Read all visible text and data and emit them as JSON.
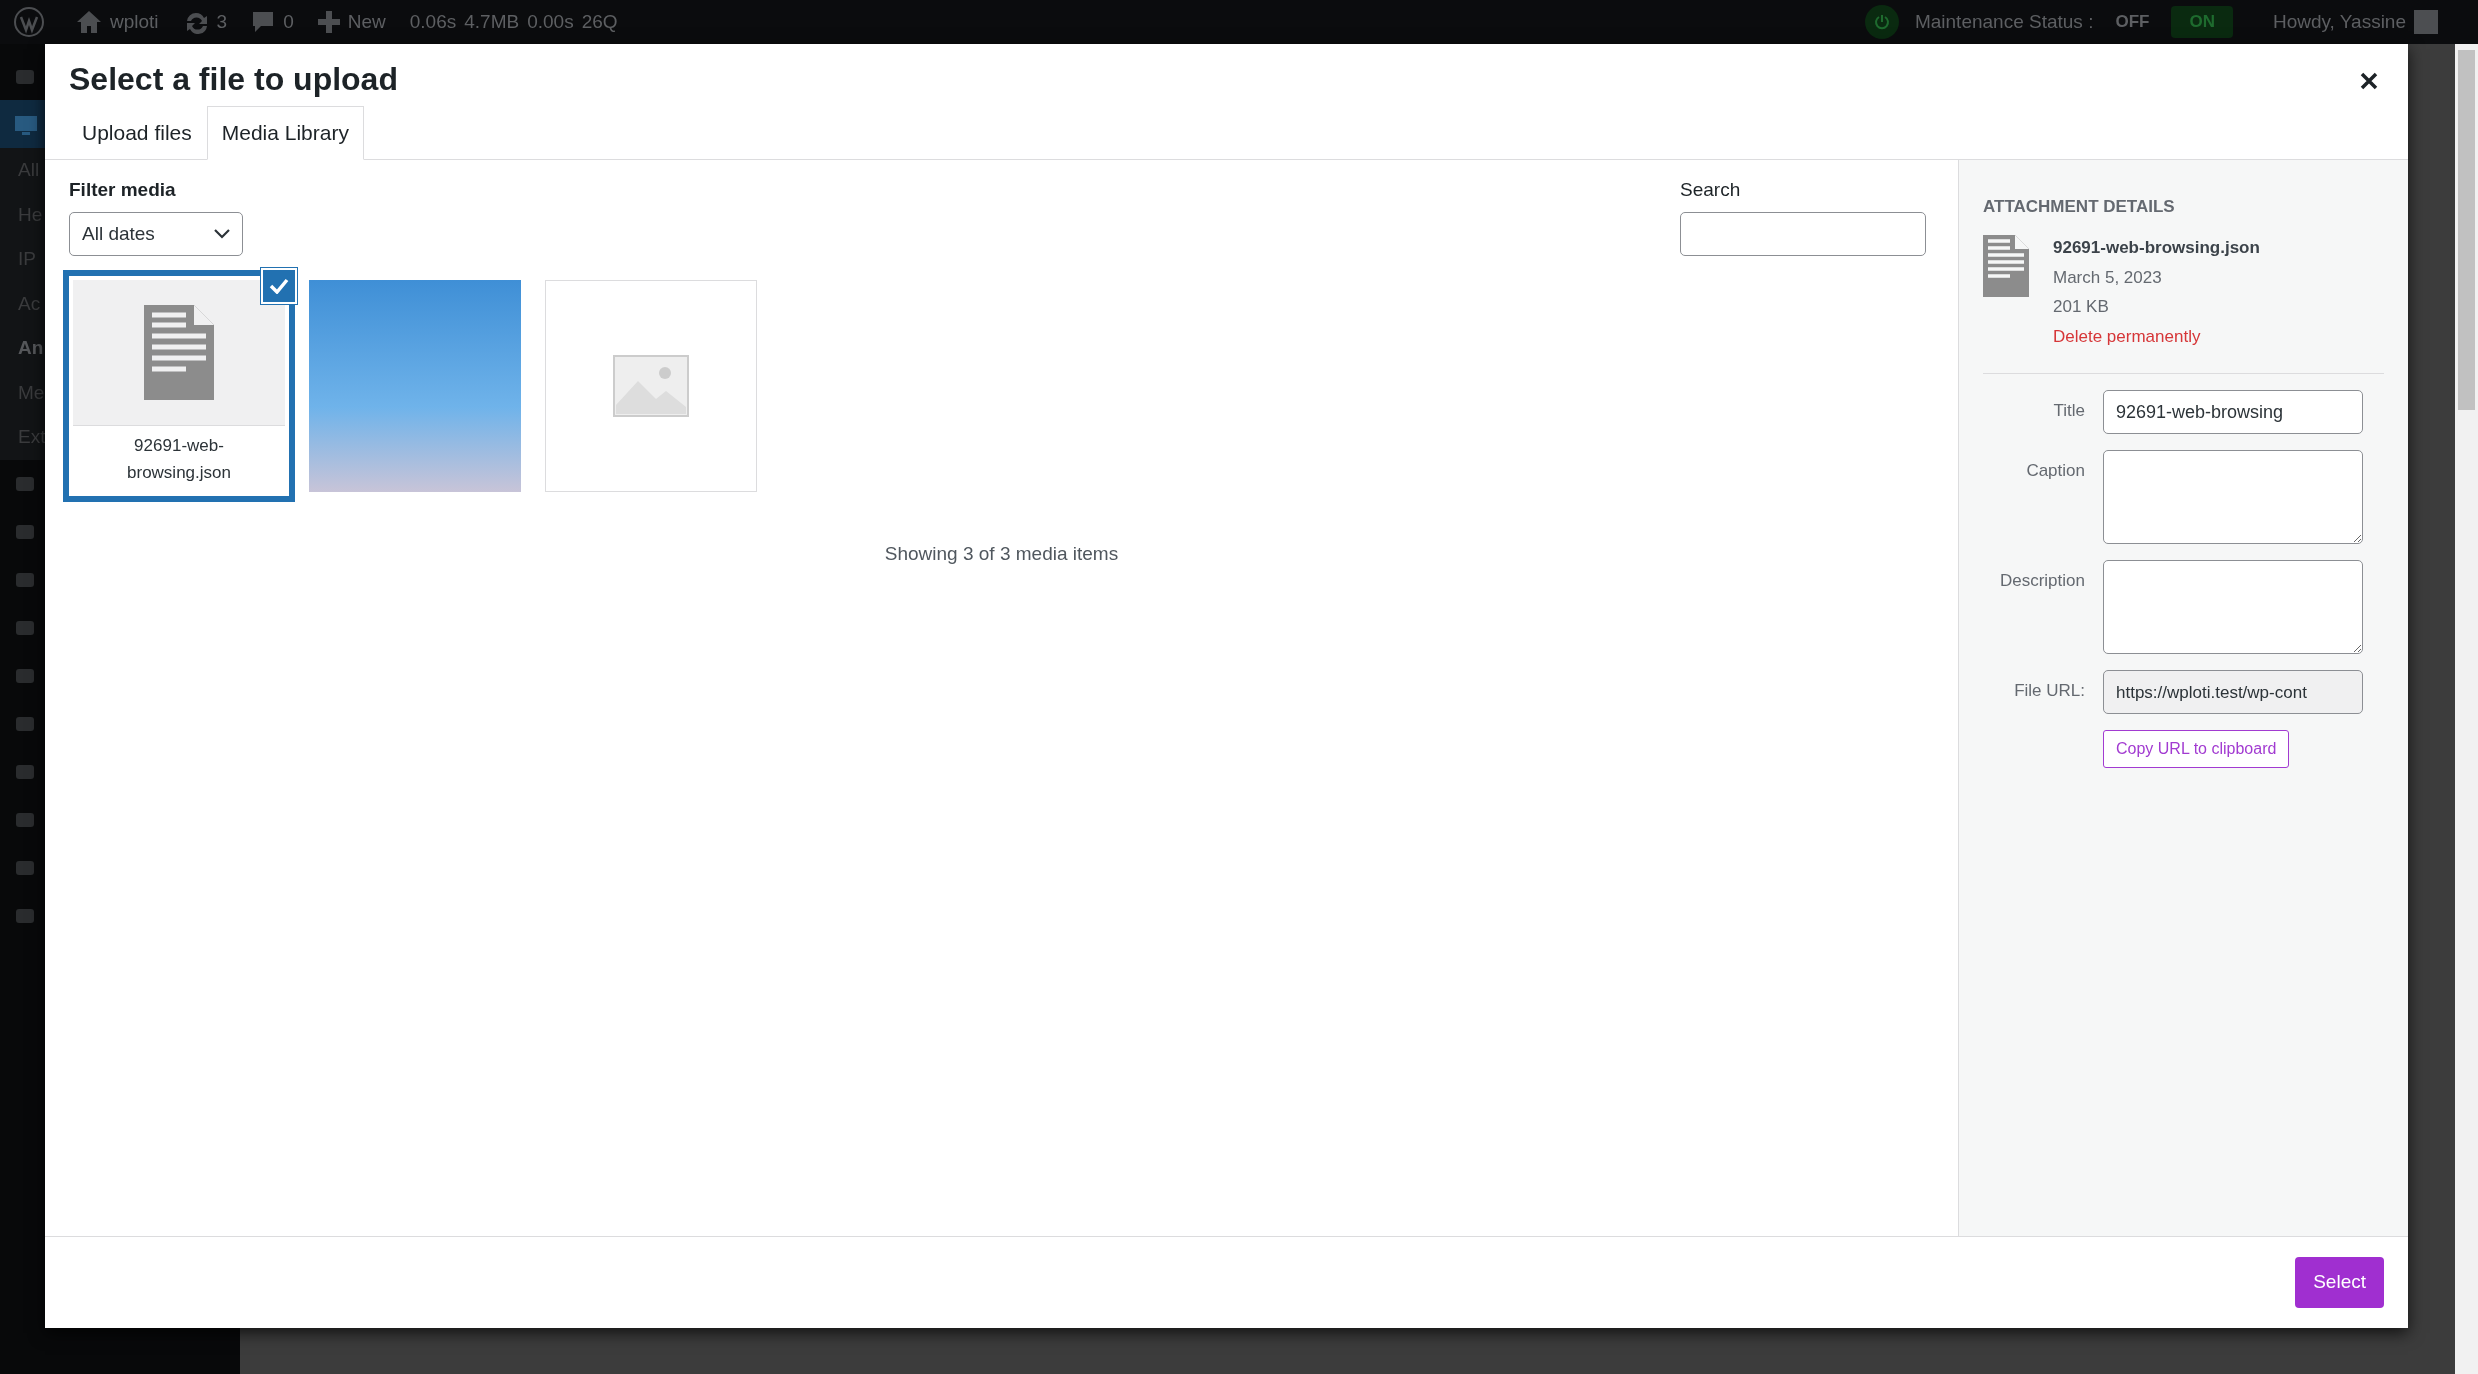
{
  "admin_bar": {
    "site": "wploti",
    "updates": "3",
    "comments": "0",
    "new": "New",
    "stats": [
      "0.06s",
      "4.7MB",
      "0.00s",
      "26Q"
    ],
    "maintenance": {
      "label": "Maintenance Status :",
      "options": [
        {
          "label": "OFF",
          "selected": false
        },
        {
          "label": "ON",
          "selected": true
        }
      ]
    },
    "greeting": "Howdy, Yassine"
  },
  "sidebar": {
    "items": [
      {
        "label": "All",
        "selected": false
      },
      {
        "label": "He",
        "selected": false
      },
      {
        "label": "IP",
        "selected": false
      },
      {
        "label": "Ac",
        "selected": false
      },
      {
        "label": "An",
        "selected": true
      },
      {
        "label": "Me",
        "selected": false
      },
      {
        "label": "Ext",
        "selected": false
      }
    ]
  },
  "modal": {
    "title": "Select a file to upload",
    "tabs": [
      {
        "label": "Upload files",
        "selected": false
      },
      {
        "label": "Media Library",
        "selected": true
      }
    ],
    "filter": {
      "label": "Filter media",
      "value": "All dates"
    },
    "search": {
      "label": "Search"
    },
    "items": [
      {
        "kind": "file",
        "name": "92691-web-browsing.json",
        "selected": true
      },
      {
        "kind": "image",
        "selected": false
      },
      {
        "kind": "placeholder",
        "selected": false
      }
    ],
    "status": "Showing 3 of 3 media items",
    "details": {
      "heading": "ATTACHMENT DETAILS",
      "filename": "92691-web-browsing.json",
      "date": "March 5, 2023",
      "size": "201 KB",
      "delete": "Delete permanently",
      "fields": [
        {
          "label": "Title",
          "kind": "text",
          "value": "92691-web-browsing"
        },
        {
          "label": "Caption",
          "kind": "textarea"
        },
        {
          "label": "Description",
          "kind": "textarea"
        },
        {
          "label": "File URL:",
          "kind": "readonly",
          "value": "https://wploti.test/wp-cont"
        }
      ],
      "copy_button": "Copy URL to clipboard"
    },
    "primary_button": "Select"
  }
}
